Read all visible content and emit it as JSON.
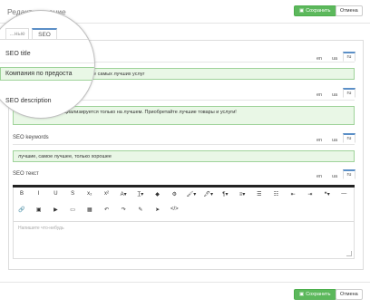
{
  "header": {
    "title": "Редактирование",
    "save_label": "Сохранить",
    "cancel_label": "Отмена"
  },
  "tabs": [
    {
      "label": "...ные"
    },
    {
      "label": "SEO"
    }
  ],
  "seo_title": {
    "label": "SEO title",
    "value": "Компания по предоста",
    "value_rest": "...вике самых лучших услуг"
  },
  "seo_description": {
    "label": "SEO description",
    "value": "Наша компания специализируется только на лучшем. Приобретайте лучшие товары и услуги!"
  },
  "seo_keywords": {
    "label": "SEO keywords",
    "value": "лучшие, самое лучшее, только хорошее"
  },
  "seo_text": {
    "label": "SEO текст",
    "placeholder": "Напишите что-нибудь"
  },
  "langs": [
    "en",
    "ua",
    "ru"
  ],
  "toolbar": {
    "row1": [
      "B",
      "I",
      "U",
      "S",
      "x₂",
      "x²",
      "A▾",
      "T̲▾",
      "◆",
      "⚙",
      "🖌▾",
      "🖋▾",
      "¶▾",
      "≡▾",
      "☰",
      "☷",
      "⇤",
      "⇥",
      "❝▾",
      "—"
    ],
    "row2": [
      "🔗",
      "▣",
      "▶",
      "▭",
      "▦",
      "↶",
      "↷",
      "✎",
      "➤",
      "</>"
    ]
  },
  "footer": {
    "save_label": "Сохранить",
    "cancel_label": "Отмена"
  }
}
